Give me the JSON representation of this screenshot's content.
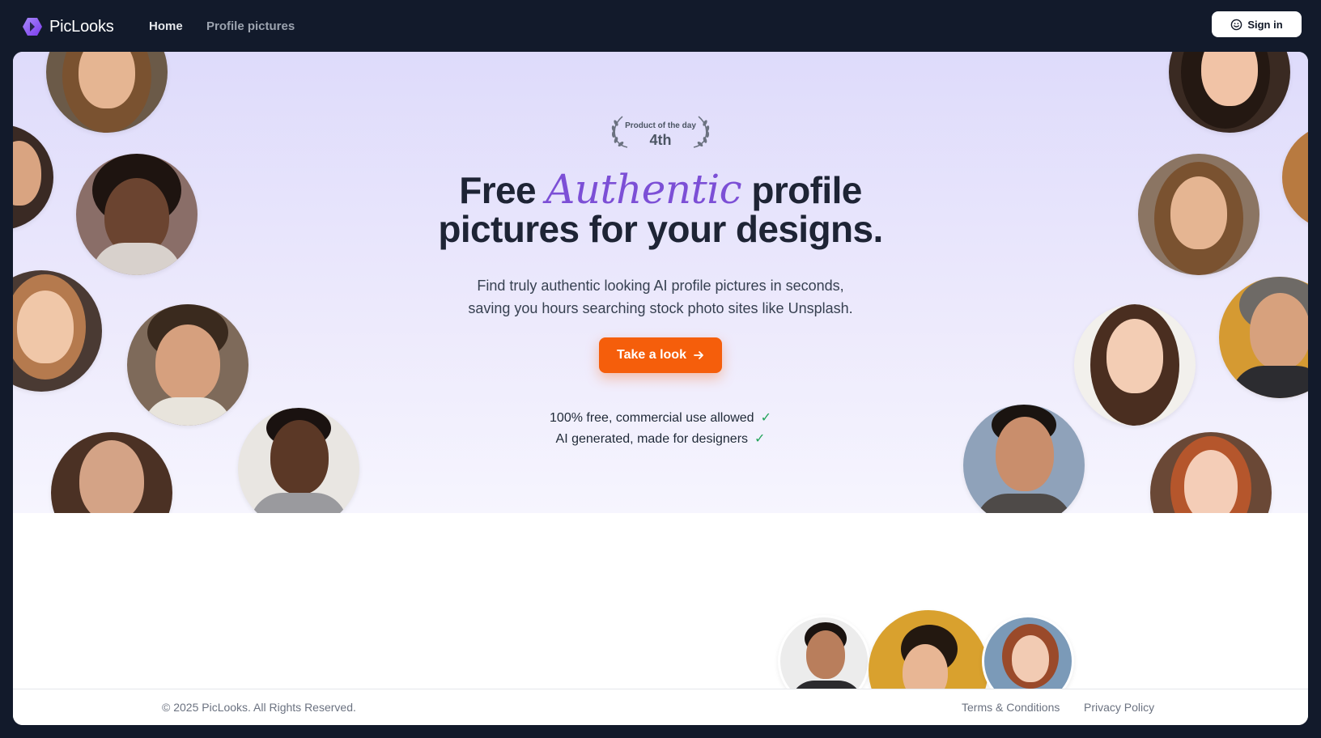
{
  "brand": {
    "name": "PicLooks",
    "accent": "#7c4fd6"
  },
  "nav": {
    "home": "Home",
    "profile_pictures": "Profile pictures",
    "sign_in": "Sign in"
  },
  "hero": {
    "badge": {
      "label": "Product of the day",
      "rank": "4th"
    },
    "headline": {
      "before": "Free",
      "accent": "Authentic",
      "after_line1": "profile",
      "line2": "pictures for your designs."
    },
    "subtitle_line1": "Find truly authentic looking AI profile pictures in seconds,",
    "subtitle_line2": "saving you hours searching stock photo sites like Unsplash.",
    "cta": {
      "label": "Take a look",
      "icon": "arrow-right-icon",
      "color": "#f55e0b"
    },
    "features": [
      "100% free, commercial use allowed",
      "AI generated, made for designers"
    ]
  },
  "footer": {
    "copyright": "© 2025 PicLooks. All Rights Reserved.",
    "terms": "Terms & Conditions",
    "privacy": "Privacy Policy"
  }
}
